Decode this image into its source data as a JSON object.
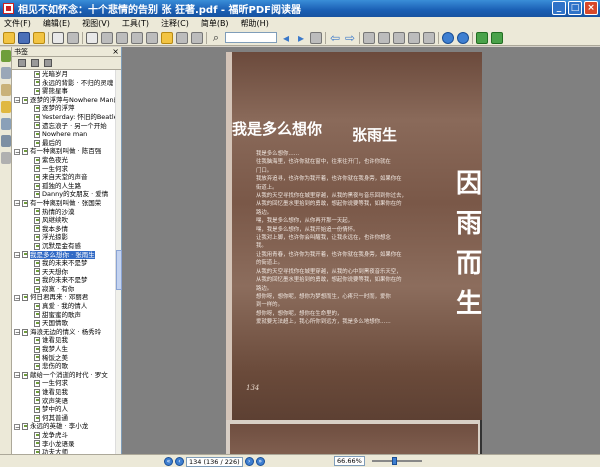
{
  "window": {
    "title": "相见不如怀念：十个悲情的告别 张 狂著.pdf - 福昕PDF阅读器"
  },
  "menu": [
    "文件(F)",
    "编辑(E)",
    "视图(V)",
    "工具(T)",
    "注释(C)",
    "简单(B)",
    "帮助(H)"
  ],
  "panel": {
    "title": "书签",
    "close_glyph": "×"
  },
  "bookmarks": [
    {
      "level": 2,
      "label": "光暗岁月"
    },
    {
      "level": 2,
      "label": "永远的背影 · 不归的灵魂"
    },
    {
      "level": 2,
      "label": "雾熊星事"
    },
    {
      "level": 1,
      "label": "逐梦的浮萍与Nowhere Man的"
    },
    {
      "level": 2,
      "label": "逐梦的浮萍"
    },
    {
      "level": 2,
      "label": "Yesterday: 怀旧的Beatles"
    },
    {
      "level": 2,
      "label": "遗忘浪子 · 另一个开始"
    },
    {
      "level": 2,
      "label": "Nowhere man"
    },
    {
      "level": 2,
      "label": "最后的"
    },
    {
      "level": 1,
      "label": "有一种离别叫做 · 陈百强"
    },
    {
      "level": 2,
      "label": "紫色夜光"
    },
    {
      "level": 2,
      "label": "一生何求"
    },
    {
      "level": 2,
      "label": "来自天堂的声音"
    },
    {
      "level": 2,
      "label": "孤独的人生路"
    },
    {
      "level": 2,
      "label": "Danny的女朋友 · 爱情"
    },
    {
      "level": 1,
      "label": "有一种离别叫做 · 张国荣"
    },
    {
      "level": 2,
      "label": "热情的沙漠"
    },
    {
      "level": 2,
      "label": "风继续吹"
    },
    {
      "level": 2,
      "label": "我本多情"
    },
    {
      "level": 2,
      "label": "浮光掠影"
    },
    {
      "level": 2,
      "label": "沉默是金有感"
    },
    {
      "level": 1,
      "label": "我是多么想你 · 张雨生",
      "selected": true
    },
    {
      "level": 2,
      "label": "我的未来不是梦"
    },
    {
      "level": 2,
      "label": "天天想你"
    },
    {
      "level": 2,
      "label": "我的未来不是梦"
    },
    {
      "level": 2,
      "label": "寂寞 · 有你"
    },
    {
      "level": 1,
      "label": "何日君再来 · 邓丽君"
    },
    {
      "level": 2,
      "label": "真爱 · 我的情人"
    },
    {
      "level": 2,
      "label": "甜蜜蜜的歌声"
    },
    {
      "level": 2,
      "label": "天国情歌"
    },
    {
      "level": 1,
      "label": "海浪无边的情义 · 杨秀玲"
    },
    {
      "level": 2,
      "label": "谁看见我"
    },
    {
      "level": 2,
      "label": "我梦人生"
    },
    {
      "level": 2,
      "label": "稀饭之美"
    },
    {
      "level": 2,
      "label": "悲伤的歌"
    },
    {
      "level": 1,
      "label": "献给一个消逝的时代 · 罗文"
    },
    {
      "level": 2,
      "label": "一生何求"
    },
    {
      "level": 2,
      "label": "谁看见我"
    },
    {
      "level": 2,
      "label": "欢声笑语"
    },
    {
      "level": 2,
      "label": "梦中的人"
    },
    {
      "level": 2,
      "label": "何其普通"
    },
    {
      "level": 1,
      "label": "永远的英雄 · 李小龙"
    },
    {
      "level": 2,
      "label": "龙争虎斗"
    },
    {
      "level": 2,
      "label": "李小龙语录"
    },
    {
      "level": 2,
      "label": "功夫大师"
    }
  ],
  "document": {
    "heading_left": "我是多么想你",
    "heading_right": "张雨生",
    "side_title_chars": [
      "因",
      "雨",
      "而",
      "生"
    ],
    "body_lines": [
      "我是多么想你……",
      "往我脑海里，也许你就在窗中，往来往开门，也许你就在",
      "门口。",
      "我放弃追寻，也许你为我开着，也许你就在我身旁，如果你在",
      "街道上。",
      "从我的天空寻找你在城里穿越，从我的黑夜与音乐回到你过去，",
      "从我的回忆墨水里拾到的勇敢，想起你说要等我，如果你在的",
      "路边。",
      "嘿，我是多么想你，从你再开那一天起，",
      "嘿，我是多么想你，从我开始追一份情怀。",
      "让我对上脚，也许你会叫醒我，让我永远在，也许你想念",
      "我。",
      "让我用青春，也许你为我开着，也许你就在我身旁，如果你在",
      "的街道上。",
      "从我的天空寻找你在城里穿越，从我的心中到黑夜音乐天空，",
      "从我的回忆墨水里拾到的勇敢，想起你说要等我，如果你在的",
      "路边。",
      "想你呀，想你呢，想你为梦想而生，心疼只一时而，爱你",
      "到一样的。",
      "想你呀，想你呢，想你在生命里的，",
      "爱就要无法超上，我心所你到远方，我是多么地想你……"
    ],
    "page_number": "134"
  },
  "status": {
    "page_field": "134 (136 / 226)",
    "zoom": "66.66%"
  }
}
